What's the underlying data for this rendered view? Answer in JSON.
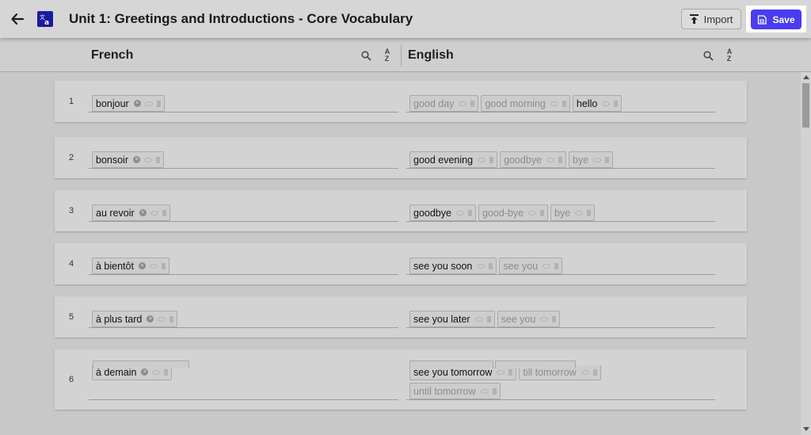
{
  "header": {
    "title": "Unit 1: Greetings and Introductions - Core Vocabulary",
    "back_icon": "arrow-left-icon",
    "logo_icon": "translate-icon",
    "import_label": "Import",
    "import_icon": "upload-icon",
    "save_label": "Save",
    "save_icon": "save-icon",
    "accent_color": "#4a3cf0"
  },
  "columns": {
    "left": {
      "label": "French"
    },
    "right": {
      "label": "English"
    },
    "search_icon": "search-icon",
    "sort_icon": "sort-az-icon",
    "sort_glyph_top": "A",
    "sort_glyph_bottom": "Z"
  },
  "rows": [
    {
      "num": "1",
      "french": [
        {
          "text": "bonjour",
          "state": "active"
        }
      ],
      "english": [
        {
          "text": "good day",
          "state": "inactive"
        },
        {
          "text": "good morning",
          "state": "inactive"
        },
        {
          "text": "hello",
          "state": "active"
        }
      ]
    },
    {
      "num": "2",
      "french": [
        {
          "text": "bonsoir",
          "state": "active"
        }
      ],
      "english": [
        {
          "text": "good evening",
          "state": "active"
        },
        {
          "text": "goodbye",
          "state": "inactive"
        },
        {
          "text": "bye",
          "state": "inactive"
        }
      ]
    },
    {
      "num": "3",
      "french": [
        {
          "text": "au revoir",
          "state": "active"
        }
      ],
      "english": [
        {
          "text": "goodbye",
          "state": "active"
        },
        {
          "text": "good-bye",
          "state": "inactive"
        },
        {
          "text": "bye",
          "state": "inactive"
        }
      ]
    },
    {
      "num": "4",
      "french": [
        {
          "text": "à bientôt",
          "state": "active"
        }
      ],
      "english": [
        {
          "text": "see you soon",
          "state": "active"
        },
        {
          "text": "see you",
          "state": "inactive"
        }
      ]
    },
    {
      "num": "5",
      "french": [
        {
          "text": "à plus tard",
          "state": "active"
        }
      ],
      "english": [
        {
          "text": "see you later",
          "state": "active"
        },
        {
          "text": "see you",
          "state": "inactive"
        }
      ]
    },
    {
      "num": "6",
      "french": [
        {
          "text": "à demain",
          "state": "active"
        }
      ],
      "english": [
        {
          "text": "see you tomorrow",
          "state": "active"
        },
        {
          "text": "till tomorrow",
          "state": "inactive"
        },
        {
          "text": "until tomorrow",
          "state": "inactive"
        }
      ]
    }
  ]
}
